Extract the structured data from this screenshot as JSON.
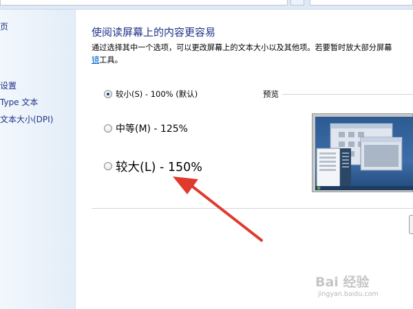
{
  "sidebar": {
    "items": [
      {
        "label": "页"
      },
      {
        "label": "设置"
      },
      {
        "label": "Type 文本"
      },
      {
        "label": "文本大小(DPI)"
      }
    ]
  },
  "main": {
    "title": "使阅读屏幕上的内容更容易",
    "description_line1": "通过选择其中一个选项，可以更改屏幕上的文本大小以及其他项。若要暂时放大部分屏幕",
    "description_link": "镜",
    "description_line2_rest": "工具。",
    "options": [
      {
        "label": "较小(S) - 100% (默认)",
        "selected": true
      },
      {
        "label": "中等(M) - 125%",
        "selected": false
      },
      {
        "label": "较大(L) - 150%",
        "selected": false
      }
    ],
    "preview_label": "预览"
  },
  "watermark": {
    "logo_text": "Bai 经验",
    "url": "jingyan.baidu.com"
  },
  "colors": {
    "link": "#0066cc",
    "title": "#1e3287",
    "arrow": "#e03a2f"
  }
}
